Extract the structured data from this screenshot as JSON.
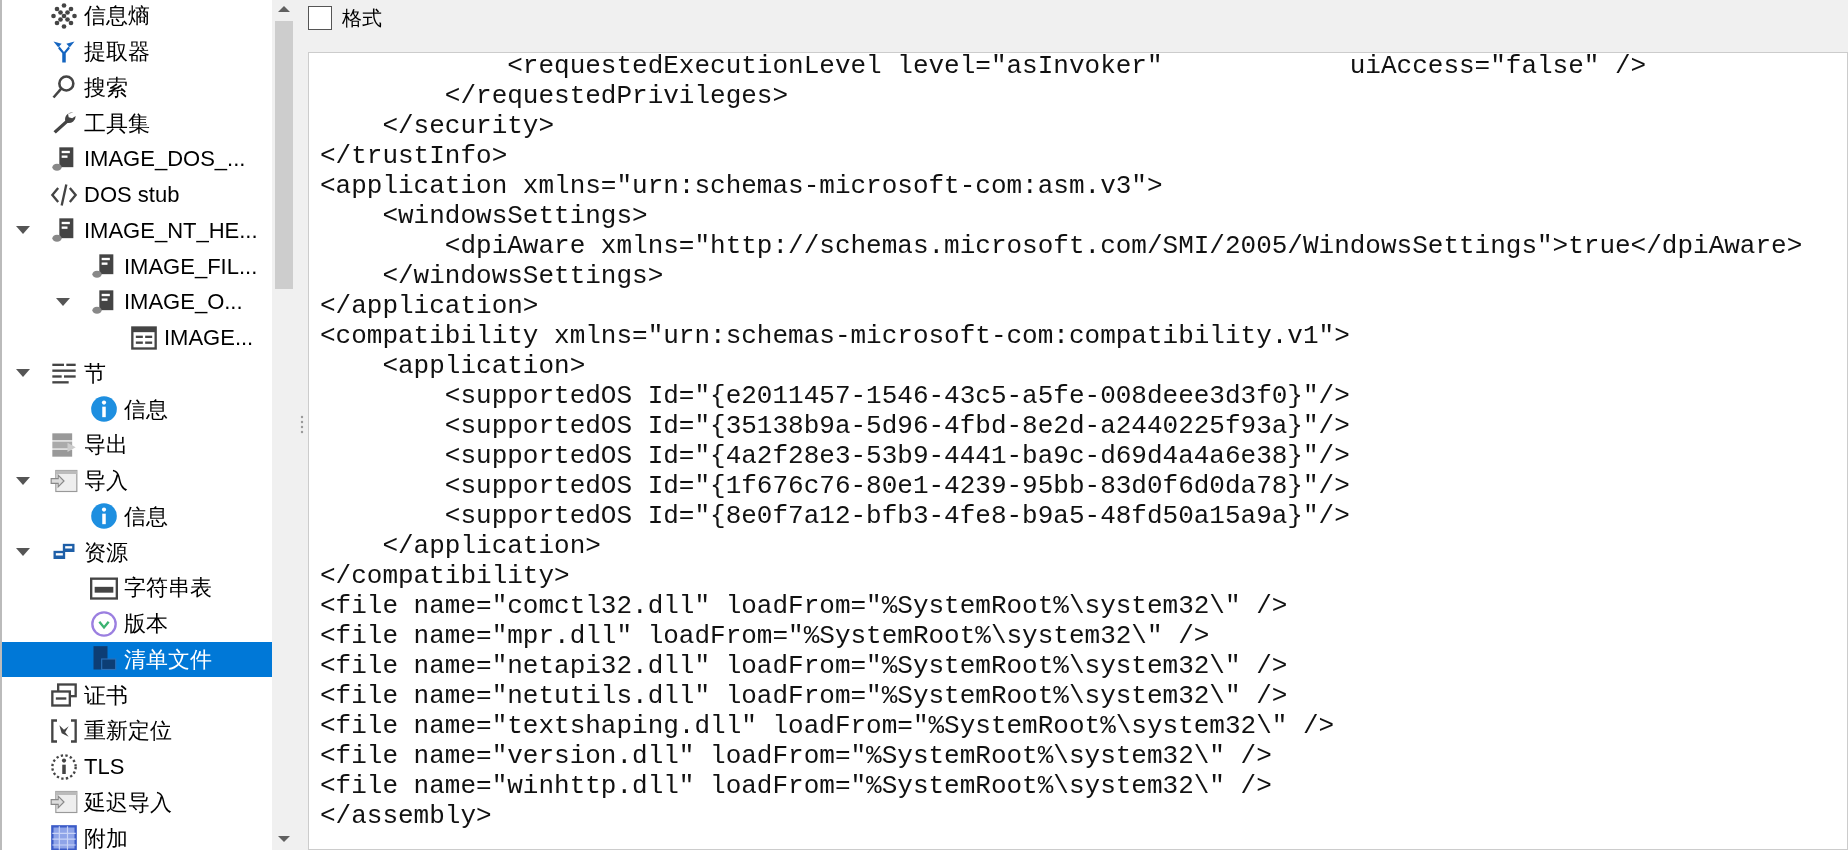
{
  "tree": [
    {
      "label": "信息熵",
      "selected": false
    },
    {
      "label": "提取器",
      "selected": false
    },
    {
      "label": "搜索",
      "selected": false
    },
    {
      "label": "工具集",
      "selected": false
    },
    {
      "label": "IMAGE_DOS_...",
      "selected": false
    },
    {
      "label": "DOS stub",
      "selected": false
    },
    {
      "label": "IMAGE_NT_HE...",
      "selected": false,
      "expanded": true,
      "children": [
        {
          "label": "IMAGE_FIL...",
          "selected": false
        },
        {
          "label": "IMAGE_O...",
          "selected": false,
          "expanded": true,
          "children": [
            {
              "label": "IMAGE...",
              "selected": false
            }
          ]
        }
      ]
    },
    {
      "label": "节",
      "selected": false,
      "expanded": true,
      "children": [
        {
          "label": "信息",
          "selected": false
        }
      ]
    },
    {
      "label": "导出",
      "selected": false
    },
    {
      "label": "导入",
      "selected": false,
      "expanded": true,
      "children": [
        {
          "label": "信息",
          "selected": false
        }
      ]
    },
    {
      "label": "资源",
      "selected": false,
      "expanded": true,
      "children": [
        {
          "label": "字符串表",
          "selected": false
        },
        {
          "label": "版本",
          "selected": false
        },
        {
          "label": "清单文件",
          "selected": true
        }
      ]
    },
    {
      "label": "证书",
      "selected": false
    },
    {
      "label": "重新定位",
      "selected": false
    },
    {
      "label": "TLS",
      "selected": false
    },
    {
      "label": "延迟导入",
      "selected": false
    },
    {
      "label": "附加",
      "selected": false
    }
  ],
  "format_checkbox": {
    "label": "格式",
    "checked": false
  },
  "code_lines": [
    "            <requestedExecutionLevel level=\"asInvoker\"            uiAccess=\"false\" />",
    "        </requestedPrivileges>",
    "    </security>",
    "</trustInfo>",
    "<application xmlns=\"urn:schemas-microsoft-com:asm.v3\">",
    "    <windowsSettings>",
    "        <dpiAware xmlns=\"http://schemas.microsoft.com/SMI/2005/WindowsSettings\">true</dpiAware>",
    "    </windowsSettings>",
    "</application>",
    "<compatibility xmlns=\"urn:schemas-microsoft-com:compatibility.v1\">",
    "    <application>",
    "        <supportedOS Id=\"{e2011457-1546-43c5-a5fe-008deee3d3f0}\"/>",
    "        <supportedOS Id=\"{35138b9a-5d96-4fbd-8e2d-a2440225f93a}\"/>",
    "        <supportedOS Id=\"{4a2f28e3-53b9-4441-ba9c-d69d4a4a6e38}\"/>",
    "        <supportedOS Id=\"{1f676c76-80e1-4239-95bb-83d0f6d0da78}\"/>",
    "        <supportedOS Id=\"{8e0f7a12-bfb3-4fe8-b9a5-48fd50a15a9a}\"/>",
    "    </application>",
    "</compatibility>",
    "<file name=\"comctl32.dll\" loadFrom=\"%SystemRoot%\\system32\\\" />",
    "<file name=\"mpr.dll\" loadFrom=\"%SystemRoot%\\system32\\\" />",
    "<file name=\"netapi32.dll\" loadFrom=\"%SystemRoot%\\system32\\\" />",
    "<file name=\"netutils.dll\" loadFrom=\"%SystemRoot%\\system32\\\" />",
    "<file name=\"textshaping.dll\" loadFrom=\"%SystemRoot%\\system32\\\" />",
    "<file name=\"version.dll\" loadFrom=\"%SystemRoot%\\system32\\\" />",
    "<file name=\"winhttp.dll\" loadFrom=\"%SystemRoot%\\system32\\\" />",
    "</assembly>"
  ]
}
